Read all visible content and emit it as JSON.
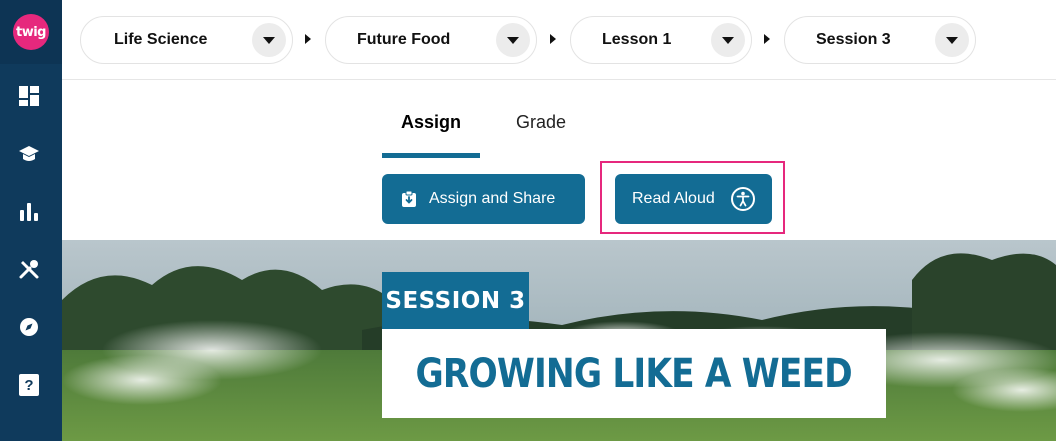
{
  "app": {
    "logo_text": "twig",
    "brand_color": "#e6287d",
    "accent_color": "#136c94",
    "sidebar_color": "#0f3a5c"
  },
  "sidebar": {
    "items": [
      {
        "icon": "dashboard-icon"
      },
      {
        "icon": "graduation-cap-icon"
      },
      {
        "icon": "bar-chart-icon"
      },
      {
        "icon": "tools-icon"
      },
      {
        "icon": "compass-icon"
      },
      {
        "icon": "help-icon",
        "label": "?"
      }
    ]
  },
  "breadcrumb": {
    "items": [
      {
        "label": "Life Science"
      },
      {
        "label": "Future Food"
      },
      {
        "label": "Lesson 1"
      },
      {
        "label": "Session 3"
      }
    ]
  },
  "tabs": [
    {
      "label": "Assign",
      "active": true
    },
    {
      "label": "Grade",
      "active": false
    }
  ],
  "actions": {
    "assign_share_label": "Assign and Share",
    "read_aloud_label": "Read Aloud"
  },
  "hero": {
    "session_label": "SESSION 3",
    "title": "GROWING LIKE A WEED"
  }
}
